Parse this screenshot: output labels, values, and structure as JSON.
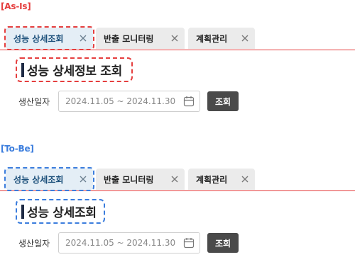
{
  "sections": [
    {
      "label": "[As-Is]",
      "label_color": "#e53e3e",
      "highlight_color": "#e53e3e",
      "tabs": [
        {
          "label": "성능 상세조회",
          "active": true
        },
        {
          "label": "반출 모니터링",
          "active": false
        },
        {
          "label": "계획관리",
          "active": false
        }
      ],
      "page_title": "성능 상세정보 조회",
      "search": {
        "field_label": "생산일자",
        "date_range": "2024.11.05 ~ 2024.11.30",
        "button_label": "조회"
      }
    },
    {
      "label": "[To-Be]",
      "label_color": "#3b7ddd",
      "highlight_color": "#3b7ddd",
      "tabs": [
        {
          "label": "성능 상세조회",
          "active": true
        },
        {
          "label": "반출 모니터링",
          "active": false
        },
        {
          "label": "계획관리",
          "active": false
        }
      ],
      "page_title": "성능 상세조회",
      "search": {
        "field_label": "생산일자",
        "date_range": "2024.11.05 ~ 2024.11.30",
        "button_label": "조회"
      }
    }
  ],
  "icons": {
    "tab_close": "close-icon",
    "calendar": "calendar-icon"
  }
}
